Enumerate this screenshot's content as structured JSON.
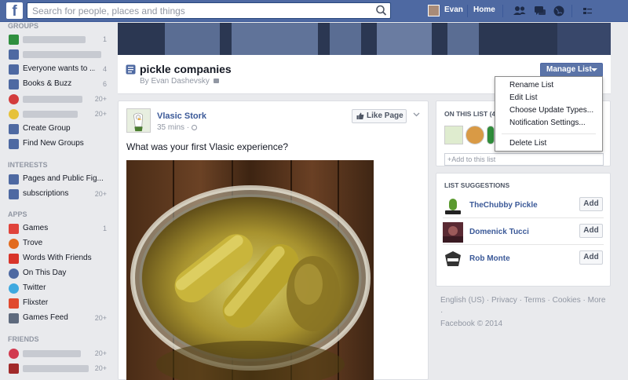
{
  "topbar": {
    "logo": "f",
    "search_placeholder": "Search for people, places and things",
    "user_name": "Evan",
    "home_label": "Home"
  },
  "sidebar": {
    "groups_heading": "GROUPS",
    "groups": [
      {
        "label": "",
        "count": "1",
        "icon_color": "#2f8f3f"
      },
      {
        "label": "",
        "count": "",
        "icon_color": "#4e69a2"
      },
      {
        "label": "Everyone wants to ...",
        "count": "4",
        "icon_color": "#4e69a2"
      },
      {
        "label": "Books & Buzz",
        "count": "6",
        "icon_color": "#4e69a2"
      },
      {
        "label": "",
        "count": "20+",
        "icon_color": "#d33c3c"
      },
      {
        "label": "",
        "count": "20+",
        "icon_color": "#e6c23a"
      },
      {
        "label": "Create Group",
        "count": "",
        "icon_color": "#4e69a2"
      },
      {
        "label": "Find New Groups",
        "count": "",
        "icon_color": "#4e69a2"
      }
    ],
    "interests_heading": "INTERESTS",
    "interests": [
      {
        "label": "Pages and Public Fig...",
        "count": "",
        "icon_color": "#4e69a2"
      },
      {
        "label": "subscriptions",
        "count": "20+",
        "icon_color": "#4e69a2"
      }
    ],
    "apps_heading": "APPS",
    "apps": [
      {
        "label": "Games",
        "count": "1",
        "icon_color": "#e0433b"
      },
      {
        "label": "Trove",
        "count": "",
        "icon_color": "#e26b1f"
      },
      {
        "label": "Words With Friends",
        "count": "",
        "icon_color": "#d8342a"
      },
      {
        "label": "On This Day",
        "count": "",
        "icon_color": "#4e69a2"
      },
      {
        "label": "Twitter",
        "count": "",
        "icon_color": "#3ea9e0"
      },
      {
        "label": "Flixster",
        "count": "",
        "icon_color": "#e04a2f"
      },
      {
        "label": "Games Feed",
        "count": "20+",
        "icon_color": "#5e6a7d"
      }
    ],
    "friends_heading": "FRIENDS",
    "friends": [
      {
        "label": "",
        "count": "20+",
        "icon_color": "#d23a4f"
      },
      {
        "label": "",
        "count": "20+",
        "icon_color": "#a12a2a"
      }
    ]
  },
  "list_header": {
    "title": "pickle companies",
    "owner": "By Evan Dashevsky",
    "manage_label": "Manage List"
  },
  "manage_menu": [
    "Rename List",
    "Edit List",
    "Choose Update Types...",
    "Notification Settings...",
    "Delete List"
  ],
  "post": {
    "page_name": "Vlasic Stork",
    "time": "35 mins",
    "like_label": "Like Page",
    "text": "What was your first Vlasic experience?"
  },
  "on_this_list": {
    "heading": "ON THIS LIST (4",
    "add_placeholder": "+Add to this list"
  },
  "suggestions": {
    "heading": "LIST SUGGESTIONS",
    "items": [
      {
        "name": "TheChubby Pickle",
        "add": "Add"
      },
      {
        "name": "Domenick Tucci",
        "add": "Add"
      },
      {
        "name": "Rob Monte",
        "add": "Add"
      }
    ]
  },
  "footer": {
    "line1": "English (US) · Privacy · Terms · Cookies · More ·",
    "line2": "Facebook © 2014"
  }
}
